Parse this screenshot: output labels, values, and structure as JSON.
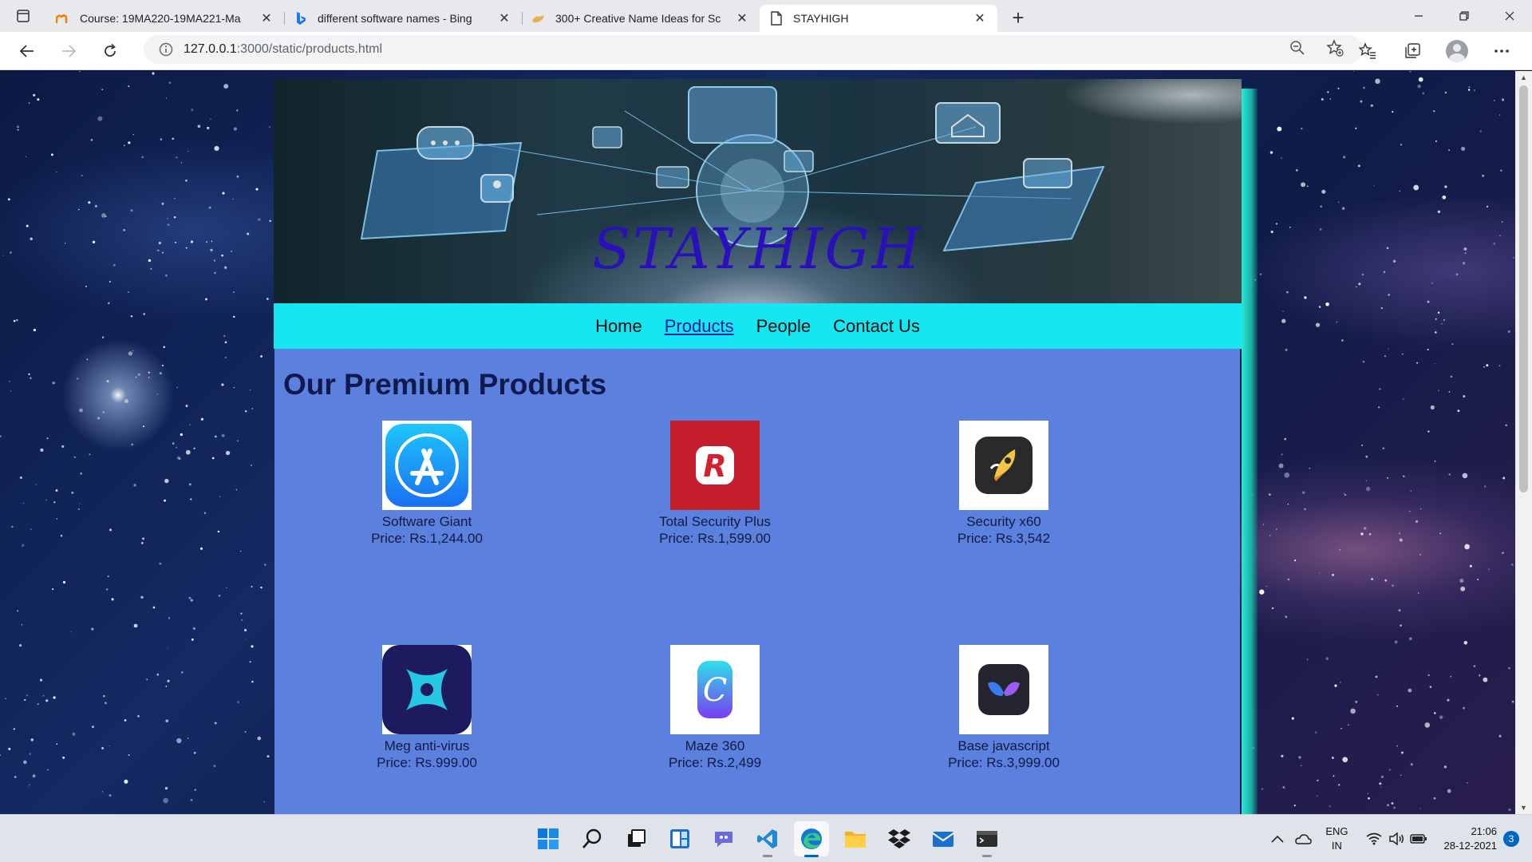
{
  "browser": {
    "tabs": [
      {
        "title": "Course: 19MA220-19MA221-Ma",
        "favicon": "moodle-icon",
        "active": false
      },
      {
        "title": "different software names - Bing",
        "favicon": "bing-icon",
        "active": false
      },
      {
        "title": "300+ Creative Name Ideas for Sc",
        "favicon": "hand-icon",
        "active": false
      },
      {
        "title": "STAYHIGH",
        "favicon": "page-icon",
        "active": true
      }
    ],
    "url_host": "127.0.0.1",
    "url_path": ":3000/static/products.html"
  },
  "site": {
    "brand": "STAYHIGH",
    "nav": [
      {
        "label": "Home",
        "current": false
      },
      {
        "label": "Products",
        "current": true
      },
      {
        "label": "People",
        "current": false
      },
      {
        "label": "Contact Us",
        "current": false
      }
    ],
    "heading": "Our Premium Products",
    "products": [
      {
        "name": "Software Giant",
        "price": "Price: Rs.1,244.00",
        "icon": "app-store-icon"
      },
      {
        "name": "Total Security Plus",
        "price": "Price: Rs.1,599.00",
        "icon": "red-r-icon"
      },
      {
        "name": "Security x60",
        "price": "Price: Rs.3,542",
        "icon": "rocket-icon"
      },
      {
        "name": "Meg anti-virus",
        "price": "Price: Rs.999.00",
        "icon": "x-logo-icon"
      },
      {
        "name": "Maze 360",
        "price": "Price: Rs.2,499",
        "icon": "c-logo-icon"
      },
      {
        "name": "Base javascript",
        "price": "Price: Rs.3,999.00",
        "icon": "butterfly-icon"
      }
    ]
  },
  "taskbar": {
    "lang_top": "ENG",
    "lang_bottom": "IN",
    "time": "21:06",
    "date": "28-12-2021",
    "notifications": "3"
  },
  "colors": {
    "nav_bg": "#16e6f2",
    "content_bg": "#5b80de",
    "brand_text": "#2a10b8",
    "heading_text": "#101a4f"
  }
}
